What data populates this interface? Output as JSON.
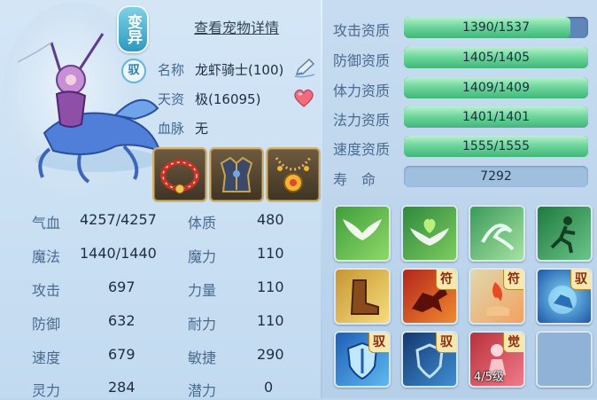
{
  "header": {
    "variant_badge": "变异",
    "ride_badge": "驭",
    "detail_link": "查看宠物详情"
  },
  "info": {
    "name_label": "名称",
    "name_value": "龙虾骑士(100)",
    "talent_label": "天资",
    "talent_value": "极(16095)",
    "blood_label": "血脉",
    "blood_value": "无"
  },
  "equipment": [
    "collar-icon",
    "armor-icon",
    "amulet-icon"
  ],
  "stats": {
    "hp_label": "气血",
    "hp_value": "4257/4257",
    "constitution_label": "体质",
    "constitution_value": "480",
    "mp_label": "魔法",
    "mp_value": "1440/1440",
    "magic_label": "魔力",
    "magic_value": "110",
    "attack_label": "攻击",
    "attack_value": "697",
    "strength_label": "力量",
    "strength_value": "110",
    "defense_label": "防御",
    "defense_value": "632",
    "endurance_label": "耐力",
    "endurance_value": "110",
    "speed_label": "速度",
    "speed_value": "679",
    "agility_label": "敏捷",
    "agility_value": "290",
    "spirit_label": "灵力",
    "spirit_value": "284",
    "potential_label": "潜力",
    "potential_value": "0"
  },
  "aptitudes": [
    {
      "label": "攻击资质",
      "text": "1390/1537",
      "current": 1390,
      "max": 1537
    },
    {
      "label": "防御资质",
      "text": "1405/1405",
      "current": 1405,
      "max": 1405
    },
    {
      "label": "体力资质",
      "text": "1409/1409",
      "current": 1409,
      "max": 1409
    },
    {
      "label": "法力资质",
      "text": "1401/1401",
      "current": 1401,
      "max": 1401
    },
    {
      "label": "速度资质",
      "text": "1555/1555",
      "current": 1555,
      "max": 1555
    }
  ],
  "lifespan": {
    "label": "寿　命",
    "value": "7292"
  },
  "skills": [
    {
      "icon": "white-wings-icon",
      "tag": ""
    },
    {
      "icon": "green-heart-wings-icon",
      "tag": ""
    },
    {
      "icon": "green-wind-swirl-icon",
      "tag": ""
    },
    {
      "icon": "running-figure-icon",
      "tag": ""
    },
    {
      "icon": "boot-icon",
      "tag": ""
    },
    {
      "icon": "red-beast-icon",
      "tag": "符"
    },
    {
      "icon": "fire-hand-icon",
      "tag": "符"
    },
    {
      "icon": "blue-orb-beast-icon",
      "tag": "驭"
    },
    {
      "icon": "blue-shield-icon",
      "tag": "驭"
    },
    {
      "icon": "dark-shield-icon",
      "tag": "驭"
    },
    {
      "icon": "awaken-figure-icon",
      "tag": "觉",
      "level": "4/5级"
    },
    {
      "icon": "empty-slot",
      "tag": ""
    }
  ],
  "colors": {
    "bar_fill": "#6fd79c",
    "bar_track": "#5f86b9",
    "label": "#4a6a90"
  }
}
